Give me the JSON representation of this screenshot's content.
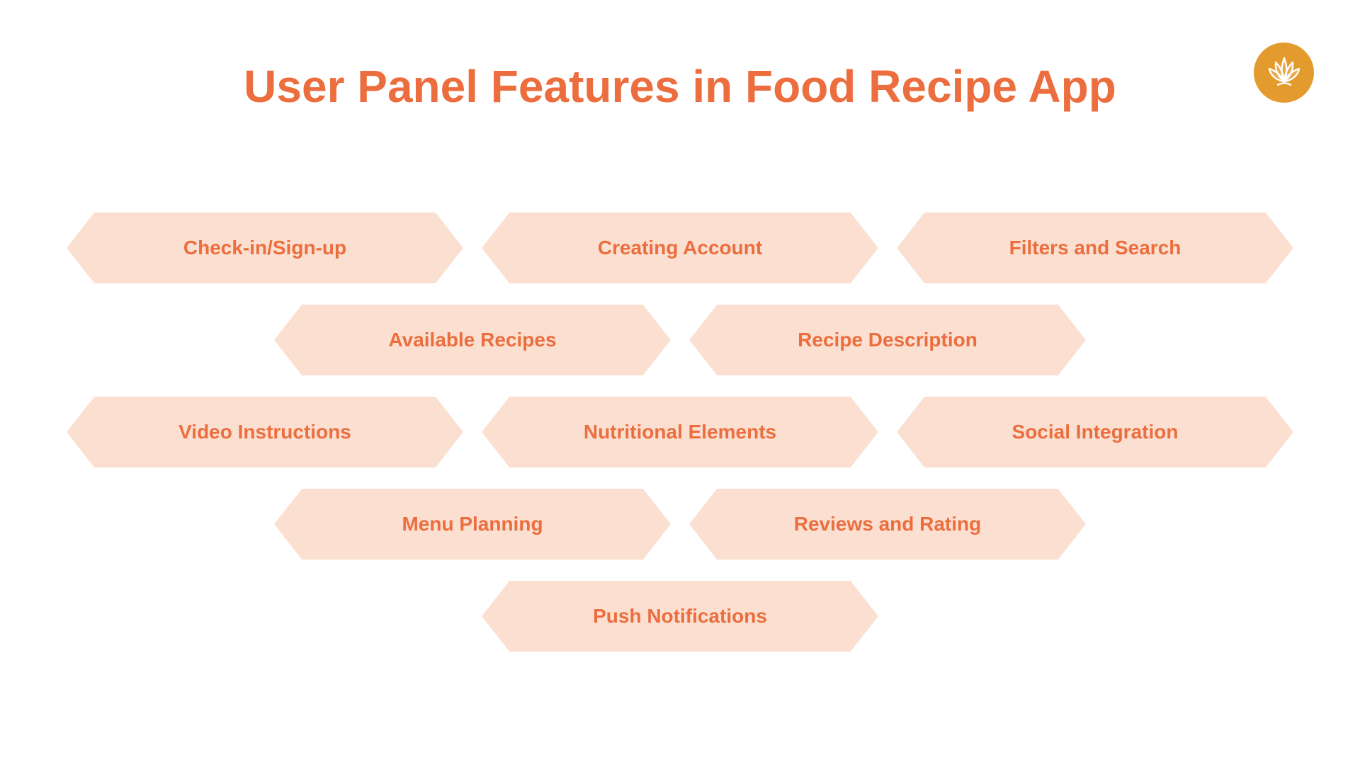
{
  "title": "User Panel Features in Food Recipe App",
  "rows": [
    [
      "Check-in/Sign-up",
      "Creating Account",
      "Filters and Search"
    ],
    [
      "Available Recipes",
      "Recipe Description"
    ],
    [
      "Video Instructions",
      "Nutritional Elements",
      "Social Integration"
    ],
    [
      "Menu Planning",
      "Reviews and Rating"
    ],
    [
      "Push Notifications"
    ]
  ]
}
